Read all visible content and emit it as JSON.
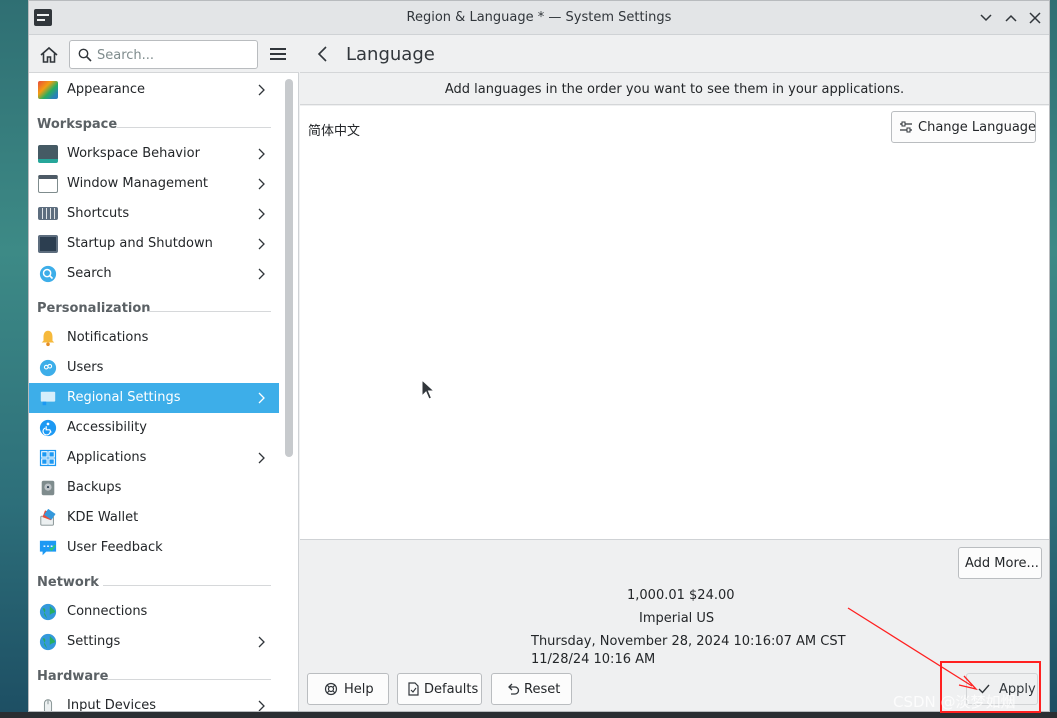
{
  "window": {
    "title": "Region & Language * — System Settings"
  },
  "sidebar": {
    "search_placeholder": "Search...",
    "items": [
      {
        "label": "Appearance",
        "icon": "appearance-icon",
        "chevron": true
      },
      {
        "label": "Workspace Behavior",
        "icon": "workspace-behavior-icon",
        "chevron": true
      },
      {
        "label": "Window Management",
        "icon": "window-management-icon",
        "chevron": true
      },
      {
        "label": "Shortcuts",
        "icon": "keyboard-icon",
        "chevron": true
      },
      {
        "label": "Startup and Shutdown",
        "icon": "startup-icon",
        "chevron": true
      },
      {
        "label": "Search",
        "icon": "search-icon",
        "chevron": true
      },
      {
        "label": "Notifications",
        "icon": "bell-icon",
        "chevron": false
      },
      {
        "label": "Users",
        "icon": "users-icon",
        "chevron": false
      },
      {
        "label": "Regional Settings",
        "icon": "regional-icon",
        "chevron": true,
        "active": true
      },
      {
        "label": "Accessibility",
        "icon": "accessibility-icon",
        "chevron": false
      },
      {
        "label": "Applications",
        "icon": "applications-icon",
        "chevron": true
      },
      {
        "label": "Backups",
        "icon": "backup-icon",
        "chevron": false
      },
      {
        "label": "KDE Wallet",
        "icon": "wallet-icon",
        "chevron": false
      },
      {
        "label": "User Feedback",
        "icon": "feedback-icon",
        "chevron": false
      },
      {
        "label": "Connections",
        "icon": "globe-icon",
        "chevron": false
      },
      {
        "label": "Settings",
        "icon": "globe-icon",
        "chevron": true
      },
      {
        "label": "Input Devices",
        "icon": "mouse-icon",
        "chevron": true
      }
    ],
    "categories": {
      "workspace": "Workspace",
      "personalization": "Personalization",
      "network": "Network",
      "hardware": "Hardware"
    }
  },
  "main": {
    "title": "Language",
    "info": "Add languages in the order you want to see them in your applications.",
    "languages": [
      "简体中文"
    ],
    "change_language_label": "Change Language",
    "add_more_label": "Add More...",
    "format_examples": {
      "numbers": "1,000.01 $24.00",
      "measurement": "Imperial US",
      "long_date": "Thursday, November 28, 2024 10:16:07 AM CST",
      "short_date": "11/28/24 10:16 AM"
    },
    "buttons": {
      "help": "Help",
      "defaults": "Defaults",
      "reset": "Reset",
      "apply": "Apply"
    }
  },
  "watermark": "CSDN @淡梦如烟",
  "colors": {
    "accent": "#3daee9",
    "annotation": "#ff2020"
  }
}
